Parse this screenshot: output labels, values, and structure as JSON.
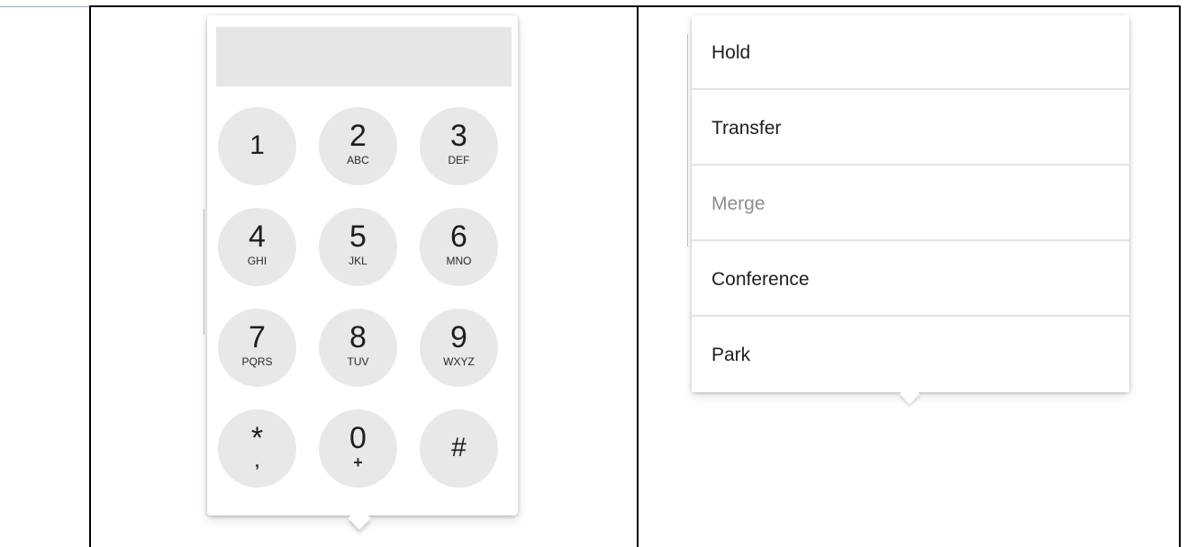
{
  "dialpad": {
    "display_value": "",
    "keys": [
      {
        "digit": "1",
        "letters": ""
      },
      {
        "digit": "2",
        "letters": "ABC"
      },
      {
        "digit": "3",
        "letters": "DEF"
      },
      {
        "digit": "4",
        "letters": "GHI"
      },
      {
        "digit": "5",
        "letters": "JKL"
      },
      {
        "digit": "6",
        "letters": "MNO"
      },
      {
        "digit": "7",
        "letters": "PQRS"
      },
      {
        "digit": "8",
        "letters": "TUV"
      },
      {
        "digit": "9",
        "letters": "WXYZ"
      },
      {
        "digit": "*",
        "letters": ","
      },
      {
        "digit": "0",
        "letters": "+"
      },
      {
        "digit": "#",
        "letters": ""
      }
    ]
  },
  "call_menu": {
    "items": [
      {
        "label": "Hold",
        "enabled": true
      },
      {
        "label": "Transfer",
        "enabled": true
      },
      {
        "label": "Merge",
        "enabled": false
      },
      {
        "label": "Conference",
        "enabled": true
      },
      {
        "label": "Park",
        "enabled": true
      }
    ]
  },
  "colors": {
    "key_background": "#e8e8e8",
    "display_background": "#e6e6e6",
    "disabled_text": "#8c8c8c",
    "table_border": "#000000"
  }
}
